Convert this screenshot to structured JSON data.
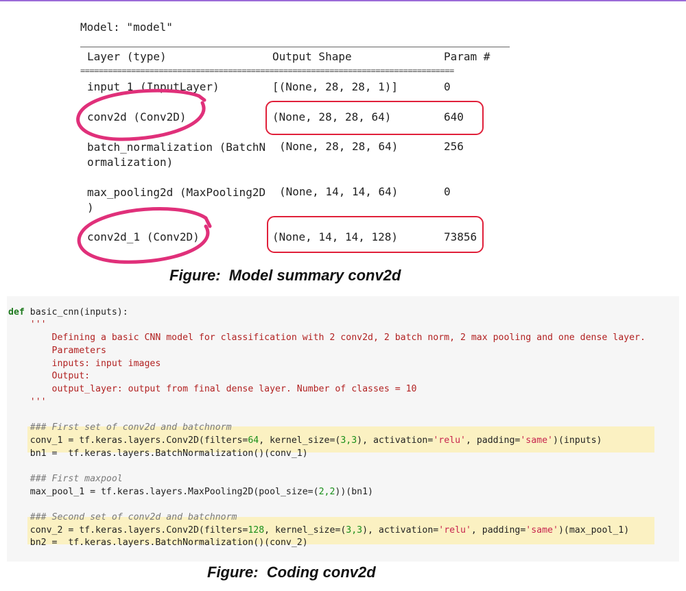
{
  "summary": {
    "model_title": "Model: \"model\"",
    "equals_rule": "=================================================================================",
    "headers": {
      "layer": "Layer (type)",
      "shape": "Output Shape",
      "params": "Param #"
    },
    "rows": [
      {
        "layer": "input_1 (InputLayer)",
        "shape": "[(None, 28, 28, 1)]",
        "params": "0"
      },
      {
        "layer": "conv2d (Conv2D)",
        "shape": "(None, 28, 28, 64)",
        "params": "640"
      },
      {
        "layer": "batch_normalization (BatchN\normalization)",
        "shape": "(None, 28, 28, 64)",
        "params": "256"
      },
      {
        "layer": "max_pooling2d (MaxPooling2D\n)",
        "shape": "(None, 14, 14, 64)",
        "params": "0"
      },
      {
        "layer": "conv2d_1 (Conv2D)",
        "shape": "(None, 14, 14, 128)",
        "params": "73856"
      }
    ],
    "annotation_color": "#e0307a"
  },
  "captions": {
    "summary": "Figure:  Model summary conv2d",
    "code": "Figure:  Coding conv2d"
  },
  "code": {
    "def_kw": "def",
    "def_rest": " basic_cnn(inputs):",
    "docq1": "    '''",
    "doc1": "        Defining a basic CNN model for classification with 2 conv2d, 2 batch norm, 2 max pooling and one dense layer.",
    "doc2": "        Parameters",
    "doc3": "        inputs: input images",
    "doc4": "        Output:",
    "doc5": "        output_layer: output from final dense layer. Number of classes = 10",
    "docq2": "    '''",
    "c1": "    ### First set of conv2d and batchnorm",
    "l1a": "    conv_1 = tf.keras.layers.Conv2D(filters=",
    "l1b": "64",
    "l1c": ", kernel_size=(",
    "l1d": "3,3",
    "l1e": "), activation=",
    "l1f": "'relu'",
    "l1g": ", padding=",
    "l1h": "'same'",
    "l1i": ")(inputs)",
    "l2": "    bn1 =  tf.keras.layers.BatchNormalization()(conv_1)",
    "c2": "    ### First maxpool",
    "l3a": "    max_pool_1 = tf.keras.layers.MaxPooling2D(pool_size=(",
    "l3b": "2,2",
    "l3c": "))(bn1)",
    "c3": "    ### Second set of conv2d and batchnorm",
    "l4a": "    conv_2 = tf.keras.layers.Conv2D(filters=",
    "l4b": "128",
    "l4c": ", kernel_size=(",
    "l4d": "3,3",
    "l4e": "), activation=",
    "l4f": "'relu'",
    "l4g": ", padding=",
    "l4h": "'same'",
    "l4i": ")(max_pool_1)",
    "l5": "    bn2 =  tf.keras.layers.BatchNormalization()(conv_2)"
  }
}
